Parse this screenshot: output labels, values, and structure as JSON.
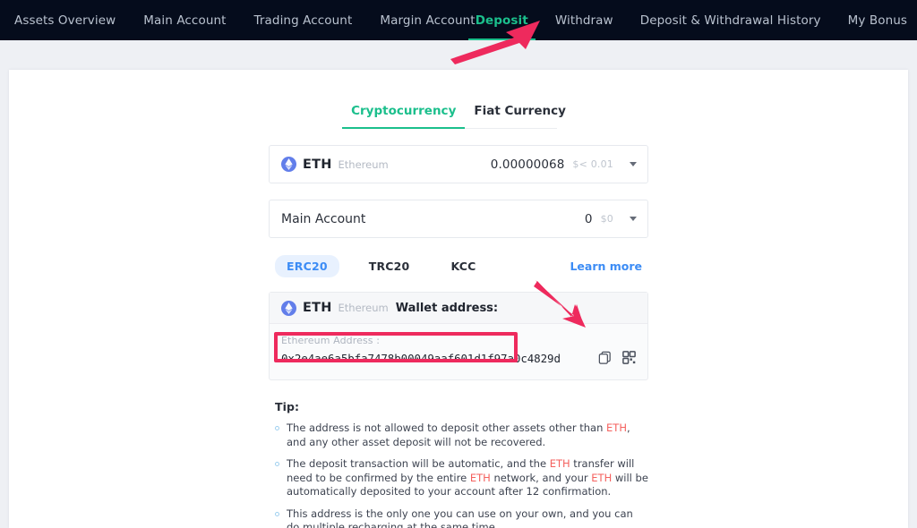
{
  "nav": {
    "left_items": [
      {
        "label": "Assets Overview",
        "active": false
      },
      {
        "label": "Main Account",
        "active": false
      },
      {
        "label": "Trading Account",
        "active": false
      },
      {
        "label": "Margin Account",
        "active": false
      }
    ],
    "right_items": [
      {
        "label": "Deposit",
        "active": true
      },
      {
        "label": "Withdraw",
        "active": false
      },
      {
        "label": "Deposit & Withdrawal History",
        "active": false
      },
      {
        "label": "My Bonus",
        "active": false
      }
    ],
    "background_color": "#050c1c",
    "active_color": "#1bbf8c"
  },
  "currency_tabs": [
    {
      "label": "Cryptocurrency",
      "active": true
    },
    {
      "label": "Fiat Currency",
      "active": false
    }
  ],
  "coin_row": {
    "icon": "ethereum-logo-icon",
    "symbol": "ETH",
    "name": "Ethereum",
    "balance": "0.00000068",
    "usd_value": "$< 0.01",
    "caret": "chevron-down-icon"
  },
  "account_row": {
    "name": "Main Account",
    "balance": "0",
    "usd_value": "$0",
    "caret": "chevron-down-icon"
  },
  "chains": [
    {
      "label": "ERC20",
      "active": true
    },
    {
      "label": "TRC20",
      "active": false
    },
    {
      "label": "KCC",
      "active": false
    }
  ],
  "learn_more": "Learn more",
  "address_panel": {
    "symbol": "ETH",
    "name": "Ethereum",
    "wallet_label": "Wallet address:",
    "caption": "Ethereum Address :",
    "address": "0x2e4ae6a5bfa7478b00049aaf601d1f97a0c4829d",
    "copy_icon": "copy-icon",
    "qr_icon": "qr-code-icon"
  },
  "tips": {
    "title": "Tip:",
    "items": [
      {
        "parts": [
          {
            "text": "The address is not allowed to deposit other assets other than ",
            "highlight": false
          },
          {
            "text": "ETH",
            "highlight": true
          },
          {
            "text": ", and any other asset deposit will not be recovered.",
            "highlight": false
          }
        ]
      },
      {
        "parts": [
          {
            "text": "The deposit transaction will be automatic, and the ",
            "highlight": false
          },
          {
            "text": "ETH",
            "highlight": true
          },
          {
            "text": " transfer will need to be confirmed by the entire ",
            "highlight": false
          },
          {
            "text": "ETH",
            "highlight": true
          },
          {
            "text": " network, and your ",
            "highlight": false
          },
          {
            "text": "ETH",
            "highlight": true
          },
          {
            "text": " will be automatically deposited to your account after 12 confirmation.",
            "highlight": false
          }
        ]
      },
      {
        "parts": [
          {
            "text": "This address is the only one you can use on your own, and you can do multiple recharging at the same time.",
            "highlight": false
          }
        ]
      }
    ]
  },
  "annotations": {
    "color": "#ee2a5d",
    "arrow_to_deposit_tab": "arrow-pointing-to-deposit-tab",
    "arrow_to_copy_icon": "arrow-pointing-to-copy-icon",
    "address_highlight_box": "red-rectangle-around-wallet-address"
  }
}
